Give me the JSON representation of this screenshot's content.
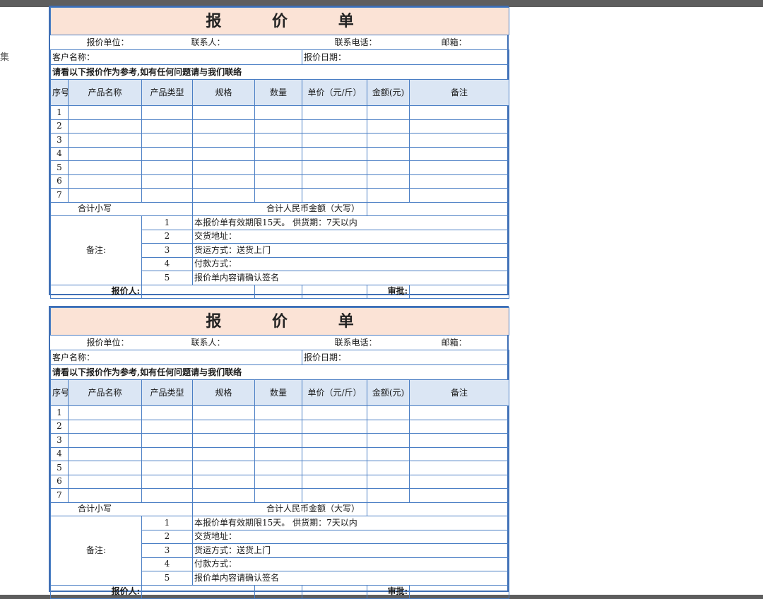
{
  "edge_glyph": "集",
  "forms": [
    {
      "title": "报 价 单",
      "labels": {
        "unit": "报价单位：",
        "contact": "联系人：",
        "phone": "联系电话：",
        "email": "邮箱：",
        "customer": "客户名称：",
        "date": "报价日期：",
        "intro": "请看以下报价作为参考,如有任何问题请与我们联络"
      },
      "columns": [
        "序号",
        "产品名称",
        "产品类型",
        "规格",
        "数量",
        "单价（元/斤）",
        "金额(元)",
        "备注"
      ],
      "rows": [
        "1",
        "2",
        "3",
        "4",
        "5",
        "6",
        "7"
      ],
      "total_small": "合计小写",
      "total_big": "合计人民币金额（大写）",
      "remarks_label": "备注:",
      "remarks": [
        {
          "no": "1",
          "text": "本报价单有效期限15天。    供货期：7天以内"
        },
        {
          "no": "2",
          "text": "交货地址："
        },
        {
          "no": "3",
          "text": "货运方式：送货上门"
        },
        {
          "no": "4",
          "text": "付款方式："
        },
        {
          "no": "5",
          "text": "报价单内容请确认签名"
        }
      ],
      "quoter_label": "报价人:",
      "approver_label": "审批:"
    },
    {
      "title": "报 价 单",
      "labels": {
        "unit": "报价单位：",
        "contact": "联系人：",
        "phone": "联系电话：",
        "email": "邮箱：",
        "customer": "客户名称：",
        "date": "报价日期：",
        "intro": "请看以下报价作为参考,如有任何问题请与我们联络"
      },
      "columns": [
        "序号",
        "产品名称",
        "产品类型",
        "规格",
        "数量",
        "单价（元/斤）",
        "金额(元)",
        "备注"
      ],
      "rows": [
        "1",
        "2",
        "3",
        "4",
        "5",
        "6",
        "7"
      ],
      "total_small": "合计小写",
      "total_big": "合计人民币金额（大写）",
      "remarks_label": "备注:",
      "remarks": [
        {
          "no": "1",
          "text": "本报价单有效期限15天。    供货期：7天以内"
        },
        {
          "no": "2",
          "text": "交货地址："
        },
        {
          "no": "3",
          "text": "货运方式：送货上门"
        },
        {
          "no": "4",
          "text": "付款方式："
        },
        {
          "no": "5",
          "text": "报价单内容请确认签名"
        }
      ],
      "quoter_label": "报价人:",
      "approver_label": "审批:"
    }
  ]
}
